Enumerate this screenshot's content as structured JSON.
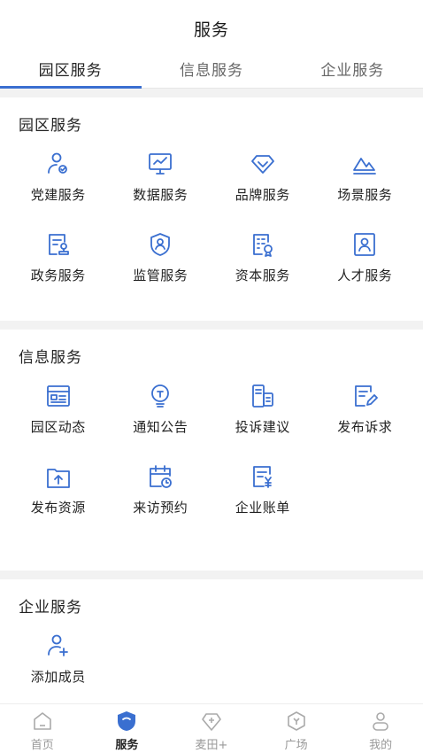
{
  "header": {
    "title": "服务"
  },
  "tabs": [
    {
      "label": "园区服务",
      "active": true
    },
    {
      "label": "信息服务",
      "active": false
    },
    {
      "label": "企业服务",
      "active": false
    }
  ],
  "accent_color": "#3a6fd0",
  "sections": [
    {
      "title": "园区服务",
      "items": [
        {
          "label": "党建服务",
          "icon": "user-badge-icon"
        },
        {
          "label": "数据服务",
          "icon": "monitor-chart-icon"
        },
        {
          "label": "品牌服务",
          "icon": "diamond-icon"
        },
        {
          "label": "场景服务",
          "icon": "mountain-icon"
        },
        {
          "label": "政务服务",
          "icon": "document-stamp-icon"
        },
        {
          "label": "监管服务",
          "icon": "shield-user-icon"
        },
        {
          "label": "资本服务",
          "icon": "document-gear-icon"
        },
        {
          "label": "人才服务",
          "icon": "id-card-icon"
        }
      ]
    },
    {
      "title": "信息服务",
      "items": [
        {
          "label": "园区动态",
          "icon": "news-icon"
        },
        {
          "label": "通知公告",
          "icon": "bulb-icon"
        },
        {
          "label": "投诉建议",
          "icon": "feedback-icon"
        },
        {
          "label": "发布诉求",
          "icon": "edit-document-icon"
        },
        {
          "label": "发布资源",
          "icon": "upload-folder-icon"
        },
        {
          "label": "来访预约",
          "icon": "calendar-clock-icon"
        },
        {
          "label": "企业账单",
          "icon": "bill-icon"
        }
      ]
    },
    {
      "title": "企业服务",
      "items": [
        {
          "label": "添加成员",
          "icon": "add-user-icon"
        }
      ]
    }
  ],
  "nav": [
    {
      "label": "首页",
      "icon": "home-icon",
      "active": false
    },
    {
      "label": "服务",
      "icon": "service-shield-icon",
      "active": true
    },
    {
      "label": "麦田+",
      "icon": "plus-diamond-icon",
      "active": false
    },
    {
      "label": "广场",
      "icon": "hexagon-icon",
      "active": false
    },
    {
      "label": "我的",
      "icon": "profile-icon",
      "active": false
    }
  ]
}
